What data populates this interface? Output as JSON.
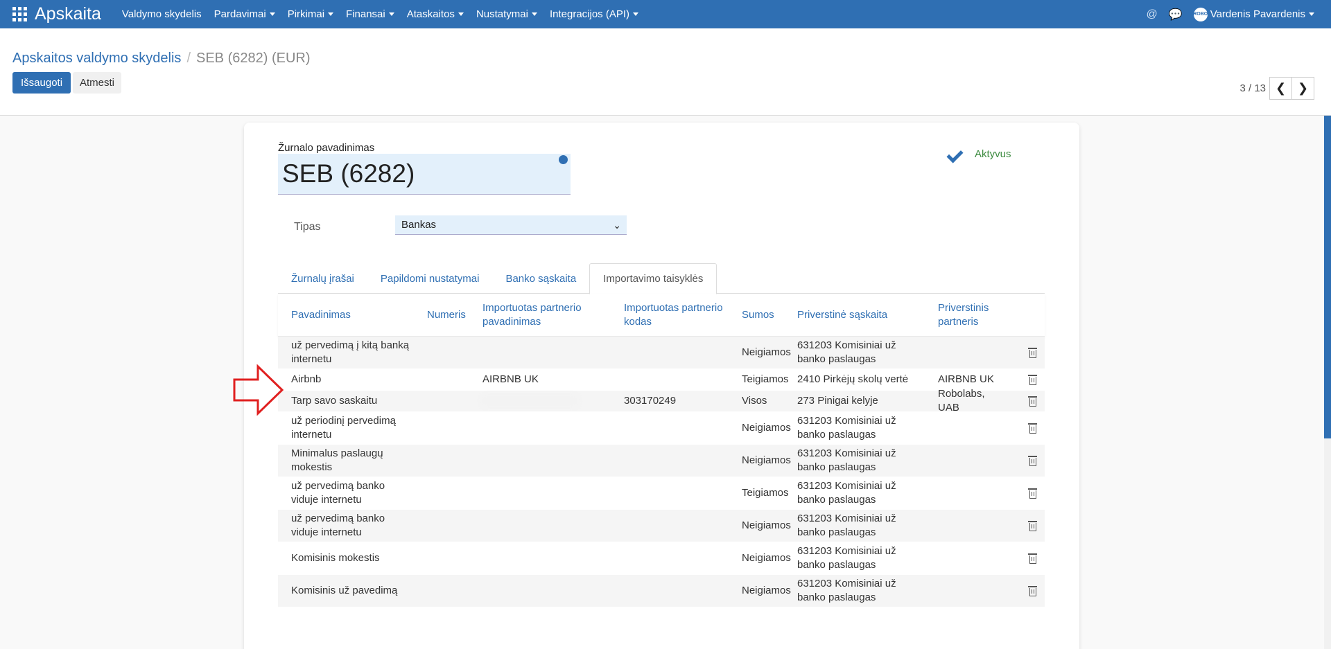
{
  "navbar": {
    "brand": "Apskaita",
    "menu": [
      {
        "label": "Valdymo skydelis",
        "dropdown": false
      },
      {
        "label": "Pardavimai",
        "dropdown": true
      },
      {
        "label": "Pirkimai",
        "dropdown": true
      },
      {
        "label": "Finansai",
        "dropdown": true
      },
      {
        "label": "Ataskaitos",
        "dropdown": true
      },
      {
        "label": "Nustatymai",
        "dropdown": true
      },
      {
        "label": "Integracijos (API)",
        "dropdown": true
      }
    ],
    "user": {
      "name": "Vardenis Pavardenis",
      "avatar_text": "ROBO"
    }
  },
  "breadcrumb": {
    "parent": "Apskaitos valdymo skydelis",
    "separator": "/",
    "current": "SEB (6282) (EUR)"
  },
  "buttons": {
    "save": "Išsaugoti",
    "discard": "Atmesti"
  },
  "pager": {
    "value": "3 / 13"
  },
  "form": {
    "journal_label": "Žurnalo pavadinimas",
    "journal_name": "SEB (6282)",
    "active_label": "Aktyvus",
    "tipas_label": "Tipas",
    "tipas_value": "Bankas"
  },
  "tabs": [
    {
      "label": "Žurnalų įrašai",
      "active": false
    },
    {
      "label": "Papildomi nustatymai",
      "active": false
    },
    {
      "label": "Banko sąskaita",
      "active": false
    },
    {
      "label": "Importavimo taisyklės",
      "active": true
    }
  ],
  "table": {
    "headers": [
      "Pavadinimas",
      "Numeris",
      "Importuotas partnerio pavadinimas",
      "Importuotas partnerio kodas",
      "Sumos",
      "Priverstinė sąskaita",
      "Priverstinis partneris"
    ],
    "rows": [
      {
        "name": "už pervedimą į kitą banką internetu",
        "number": "",
        "partner_name": "",
        "partner_code": "",
        "sums": "Neigiamos",
        "account": "631203 Komisiniai už banko paslaugas",
        "partner": "",
        "striped": true
      },
      {
        "name": "Airbnb",
        "number": "",
        "partner_name": "AIRBNB UK",
        "partner_code": "",
        "sums": "Teigiamos",
        "account": "2410 Pirkėjų skolų vertė",
        "partner": "AIRBNB UK",
        "striped": false
      },
      {
        "name": "Tarp savo saskaitu",
        "number": "",
        "partner_name": "",
        "partner_code": "303170249",
        "sums": "Visos",
        "account": "273 Pinigai kelyje",
        "partner": "Robolabs, UAB",
        "striped": true,
        "blurred": true
      },
      {
        "name": "už periodinį pervedimą internetu",
        "number": "",
        "partner_name": "",
        "partner_code": "",
        "sums": "Neigiamos",
        "account": "631203 Komisiniai už banko paslaugas",
        "partner": "",
        "striped": false
      },
      {
        "name": "Minimalus paslaugų mokestis",
        "number": "",
        "partner_name": "",
        "partner_code": "",
        "sums": "Neigiamos",
        "account": "631203 Komisiniai už banko paslaugas",
        "partner": "",
        "striped": true
      },
      {
        "name": "už pervedimą banko viduje internetu",
        "number": "",
        "partner_name": "",
        "partner_code": "",
        "sums": "Teigiamos",
        "account": "631203 Komisiniai už banko paslaugas",
        "partner": "",
        "striped": false
      },
      {
        "name": "už pervedimą banko viduje internetu",
        "number": "",
        "partner_name": "",
        "partner_code": "",
        "sums": "Neigiamos",
        "account": "631203 Komisiniai už banko paslaugas",
        "partner": "",
        "striped": true
      },
      {
        "name": "Komisinis mokestis",
        "number": "",
        "partner_name": "",
        "partner_code": "",
        "sums": "Neigiamos",
        "account": "631203 Komisiniai už banko paslaugas",
        "partner": "",
        "striped": false
      },
      {
        "name": "Komisinis už pavedimą",
        "number": "",
        "partner_name": "",
        "partner_code": "",
        "sums": "Neigiamos",
        "account": "631203 Komisiniai už banko paslaugas",
        "partner": "",
        "striped": true
      }
    ]
  },
  "colors": {
    "primary": "#2f6fb3",
    "active_green": "#3d8b40",
    "arrow_red": "#e02020"
  },
  "icons": {
    "apps": "apps-grid-icon",
    "at": "at-icon",
    "chat": "chat-icon",
    "globe": "globe-icon",
    "check": "check-icon",
    "trash": "trash-icon",
    "arrow": "arrow-right-icon"
  }
}
